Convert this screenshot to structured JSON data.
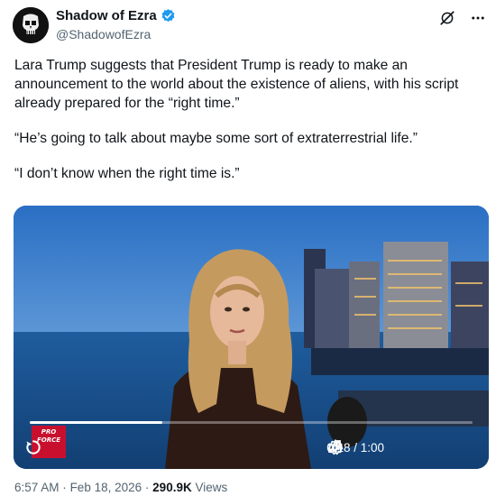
{
  "author": {
    "display_name": "Shadow of Ezra",
    "handle": "@ShadowofEzra",
    "verified": true
  },
  "tweet": {
    "paragraphs": [
      "Lara Trump suggests that President Trump is ready to make an announcement to the world about the existence of aliens, with his script already prepared for the “right time.”",
      "“He’s going to talk about maybe some sort of extraterrestrial life.”",
      "“I don’t know when the right time is.”"
    ]
  },
  "video": {
    "elapsed": "0:18",
    "duration": "1:00",
    "time_display": "0:18 / 1:00",
    "progress_fraction": 0.3,
    "brand_badge_text": "PRO FORCE"
  },
  "meta": {
    "time": "6:57 AM",
    "separator": "·",
    "date": "Feb 18, 2026",
    "views_count": "290.9K",
    "views_label": "Views"
  },
  "icons": {
    "verified": "verified-badge-icon",
    "grok": "grok-icon",
    "more": "more-options-icon",
    "replay": "replay-icon",
    "volume": "volume-icon",
    "settings": "settings-gear-icon",
    "fullscreen": "fullscreen-icon"
  },
  "colors": {
    "verified_blue": "#1d9bf0",
    "secondary_text": "#536471",
    "primary_text": "#0f1419"
  }
}
